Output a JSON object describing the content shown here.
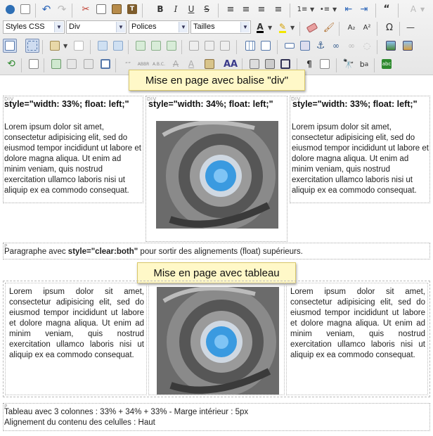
{
  "toolbar": {
    "style_combo": "Styles CSS",
    "format_combo": "Div",
    "font_combo": "Polices",
    "size_combo": "Tailles"
  },
  "callouts": {
    "div_layout": "Mise en page avec balise \"div\"",
    "table_layout": "Mise en page avec tableau"
  },
  "div_section": {
    "tag": "DIV",
    "col1_style": "style=\"width: 33%; float: left;\"",
    "col2_style": "style=\"width: 34%; float: left;\"",
    "col3_style": "style=\"width: 33%; float: left;\"",
    "lorem": "Lorem ipsum dolor sit amet, consectetur adipisicing elit, sed do eiusmod tempor incididunt ut labore et dolore magna aliqua. Ut enim ad minim veniam, quis nostrud exercitation ullamco laboris nisi ut aliquip ex ea commodo consequat."
  },
  "clear_paragraph": {
    "tag": "P",
    "before": "Paragraphe avec ",
    "bold": "style=\"clear:both\"",
    "after": " pour sortir des alignements (float) supérieurs."
  },
  "table_section": {
    "lorem": "Lorem ipsum dolor sit amet, consectetur adipisicing elit, sed do eiusmod tempor incididunt ut labore et dolore magna aliqua. Ut enim ad minim veniam, quis nostrud exercitation ullamco laboris nisi ut aliquip ex ea commodo consequat."
  },
  "footer_paragraph": {
    "tag": "P",
    "line1": "Tableau avec 3 colonnes : 33% + 34% + 33% - Marge intérieur : 5px",
    "line2": "Alignement du contenu des celulles : Haut"
  },
  "icons": [
    "source-icon",
    "new-page-icon",
    "undo-icon",
    "redo-icon",
    "cut-icon",
    "copy-icon",
    "paste-icon",
    "paste-text-icon",
    "bold-icon",
    "italic-icon",
    "underline-icon",
    "strike-icon",
    "justify-icon",
    "align-left-icon",
    "align-center-icon",
    "align-right-icon",
    "numbered-list-icon",
    "bullet-list-icon",
    "outdent-icon",
    "indent-icon",
    "blockquote-icon",
    "text-color-icon",
    "highlight-icon",
    "eraser-icon",
    "format-painter-icon",
    "subscript-icon",
    "superscript-icon",
    "special-char-icon",
    "horizontal-rule-icon",
    "image-icon",
    "link-icon",
    "anchor-icon",
    "table-icon",
    "find-icon",
    "replace-icon",
    "spellcheck-icon",
    "maximize-icon",
    "print-icon",
    "show-blocks-icon"
  ]
}
